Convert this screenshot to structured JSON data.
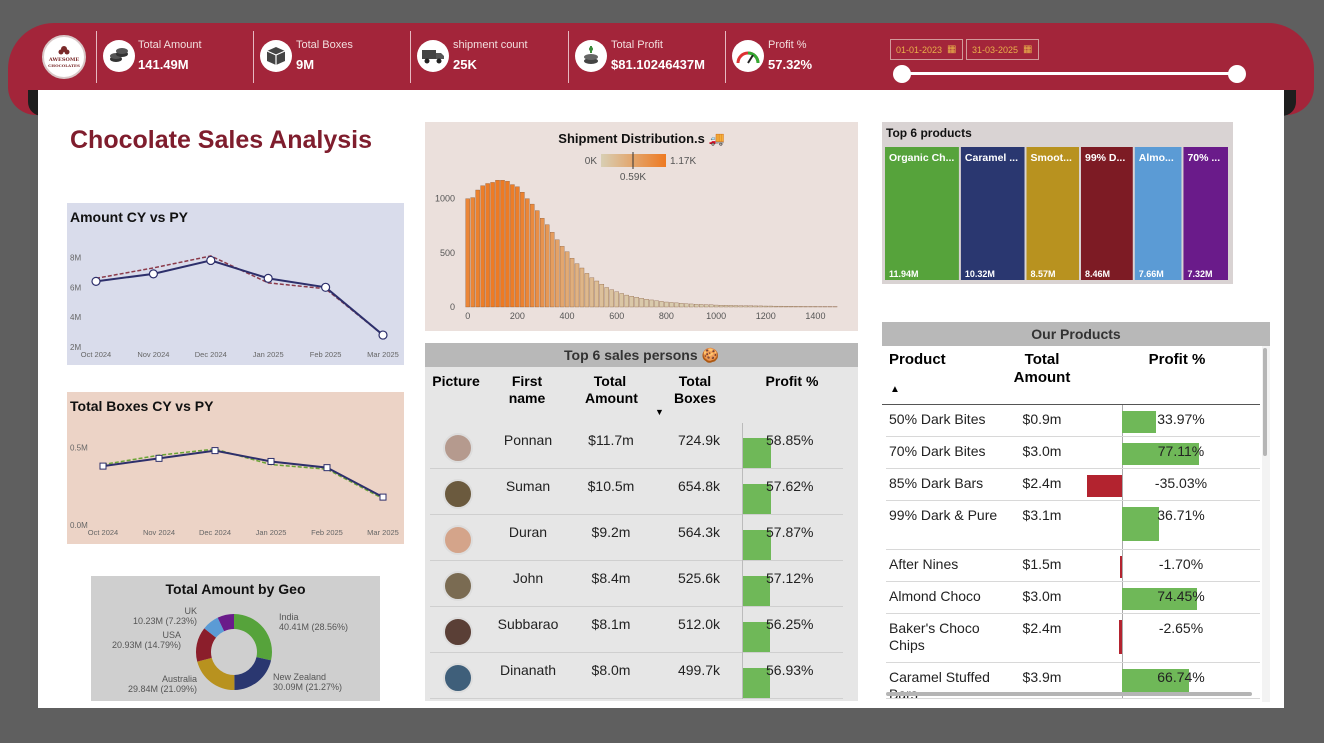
{
  "header": {
    "logo_line1": "AWESOME",
    "logo_line2": "CHOCOLATES",
    "kpis": [
      {
        "label": "Total Amount",
        "value": "141.49M",
        "icon": "coins-icon"
      },
      {
        "label": "Total Boxes",
        "value": "9M",
        "icon": "box-icon"
      },
      {
        "label": "shipment count",
        "value": "25K",
        "icon": "truck-icon"
      },
      {
        "label": "Total Profit",
        "value": "$81.10246437M",
        "icon": "money-icon"
      },
      {
        "label": "Profit %",
        "value": "57.32%",
        "icon": "gauge-icon"
      }
    ],
    "date_start": "01-01-2023",
    "date_end": "31-03-2025"
  },
  "page_title": "Chocolate Sales Analysis",
  "chart_data": [
    {
      "type": "line",
      "title": "Amount CY vs PY",
      "categories": [
        "Oct 2024",
        "Nov 2024",
        "Dec 2024",
        "Jan 2025",
        "Feb 2025",
        "Mar 2025"
      ],
      "y_ticks": [
        "8M",
        "6M",
        "4M",
        "2M"
      ],
      "ylim": [
        2,
        8.5
      ],
      "series": [
        {
          "values": [
            6.4,
            6.9,
            7.8,
            6.6,
            6.0,
            2.8
          ],
          "color": "#2d2f6b",
          "style": "solid"
        },
        {
          "values": [
            6.6,
            7.3,
            8.1,
            6.3,
            5.9,
            2.8
          ],
          "color": "#8b3a4a",
          "style": "dashed"
        }
      ]
    },
    {
      "type": "line",
      "title": "Total Boxes CY vs PY",
      "categories": [
        "Oct 2024",
        "Nov 2024",
        "Dec 2024",
        "Jan 2025",
        "Feb 2025",
        "Mar 2025"
      ],
      "y_ticks": [
        "0.5M",
        "0.0M"
      ],
      "ylim": [
        0,
        0.6
      ],
      "series": [
        {
          "values": [
            0.38,
            0.43,
            0.48,
            0.41,
            0.37,
            0.18
          ],
          "color": "#2d2f6b",
          "style": "solid"
        },
        {
          "values": [
            0.39,
            0.45,
            0.49,
            0.39,
            0.36,
            0.17
          ],
          "color": "#6aa434",
          "style": "dashed"
        }
      ]
    },
    {
      "type": "bar",
      "title": "Shipment Distribution.s 🚚",
      "legend_min": "0K",
      "legend_mid": "0.59K",
      "legend_max": "1.17K",
      "x_ticks": [
        "0",
        "200",
        "400",
        "600",
        "800",
        "1000",
        "1200",
        "1400"
      ],
      "y_ticks": [
        "1000",
        "500",
        "0"
      ],
      "xlim": [
        -15,
        1515
      ],
      "ylim": [
        0,
        1200
      ],
      "bin_width": 20,
      "values": [
        1000,
        1010,
        1080,
        1120,
        1140,
        1150,
        1170,
        1170,
        1160,
        1130,
        1110,
        1060,
        1000,
        950,
        890,
        820,
        760,
        690,
        620,
        560,
        510,
        450,
        400,
        360,
        310,
        270,
        240,
        210,
        180,
        160,
        140,
        125,
        110,
        100,
        90,
        80,
        72,
        65,
        58,
        52,
        46,
        42,
        38,
        34,
        30,
        28,
        26,
        24,
        22,
        20,
        18,
        17,
        16,
        15,
        14,
        13,
        12,
        11,
        10,
        10,
        9,
        9,
        8,
        8,
        7,
        7,
        6,
        6,
        5,
        5,
        5,
        4,
        4,
        4,
        3
      ]
    },
    {
      "type": "bar",
      "title": "Top 6 products",
      "categories": [
        "Organic Ch...",
        "Caramel ...",
        "Smoot...",
        "99% D...",
        "Almo...",
        "70% ..."
      ],
      "values": [
        11.94,
        10.32,
        8.57,
        8.46,
        7.66,
        7.32
      ],
      "value_labels": [
        "11.94M",
        "10.32M",
        "8.57M",
        "8.46M",
        "7.66M",
        "7.32M"
      ],
      "colors": [
        "#56a33b",
        "#2a3770",
        "#b8921f",
        "#7d1b24",
        "#5b9bd5",
        "#6a1b8a"
      ]
    },
    {
      "type": "pie",
      "title": "Total Amount by Geo",
      "slices": [
        {
          "name": "India",
          "label": "40.41M (28.56%)",
          "value": 28.56,
          "color": "#56a33b"
        },
        {
          "name": "New Zealand",
          "label": "30.09M (21.27%)",
          "value": 21.27,
          "color": "#2a3770"
        },
        {
          "name": "Australia",
          "label": "29.84M (21.09%)",
          "value": 21.09,
          "color": "#b8921f"
        },
        {
          "name": "USA",
          "label": "20.93M (14.79%)",
          "value": 14.79,
          "color": "#8b1e2b"
        },
        {
          "name": "UK",
          "label": "10.23M (7.23%)",
          "value": 7.23,
          "color": "#5b9bd5"
        },
        {
          "name": "",
          "label": "",
          "value": 7.06,
          "color": "#6a1b8a"
        }
      ]
    }
  ],
  "sales_persons": {
    "title": "Top 6 sales persons 🍪",
    "columns": [
      "Picture",
      "First name",
      "Total Amount",
      "Total Boxes",
      "Profit %"
    ],
    "rows": [
      {
        "name": "Ponnan",
        "amount": "$11.7m",
        "boxes": "724.9k",
        "profit": "58.85%",
        "pct": 58.85
      },
      {
        "name": "Suman",
        "amount": "$10.5m",
        "boxes": "654.8k",
        "profit": "57.62%",
        "pct": 57.62
      },
      {
        "name": "Duran",
        "amount": "$9.2m",
        "boxes": "564.3k",
        "profit": "57.87%",
        "pct": 57.87
      },
      {
        "name": "John",
        "amount": "$8.4m",
        "boxes": "525.6k",
        "profit": "57.12%",
        "pct": 57.12
      },
      {
        "name": "Subbarao",
        "amount": "$8.1m",
        "boxes": "512.0k",
        "profit": "56.25%",
        "pct": 56.25
      },
      {
        "name": "Dinanath",
        "amount": "$8.0m",
        "boxes": "499.7k",
        "profit": "56.93%",
        "pct": 56.93
      }
    ]
  },
  "products": {
    "title": "Our Products",
    "columns": [
      "Product",
      "Total Amount",
      "Profit %"
    ],
    "rows": [
      {
        "name": "50% Dark Bites",
        "amount": "$0.9m",
        "profit": "33.97%",
        "pct": 33.97
      },
      {
        "name": "70% Dark Bites",
        "amount": "$3.0m",
        "profit": "77.11%",
        "pct": 77.11
      },
      {
        "name": "85% Dark Bars",
        "amount": "$2.4m",
        "profit": "-35.03%",
        "pct": -35.03
      },
      {
        "name": "99% Dark & Pure",
        "amount": "$3.1m",
        "profit": "36.71%",
        "pct": 36.71
      },
      {
        "name": "After Nines",
        "amount": "$1.5m",
        "profit": "-1.70%",
        "pct": -1.7
      },
      {
        "name": "Almond Choco",
        "amount": "$3.0m",
        "profit": "74.45%",
        "pct": 74.45
      },
      {
        "name": "Baker's Choco Chips",
        "amount": "$2.4m",
        "profit": "-2.65%",
        "pct": -2.65
      },
      {
        "name": "Caramel Stuffed Bars",
        "amount": "$3.9m",
        "profit": "66.74%",
        "pct": 66.74
      }
    ]
  }
}
